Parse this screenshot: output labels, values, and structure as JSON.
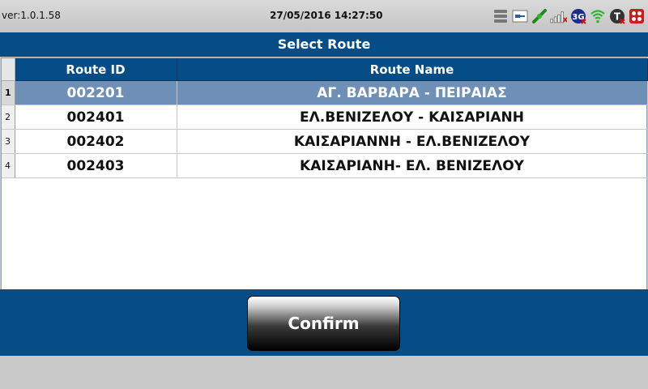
{
  "status_bar": {
    "version": "ver:1.0.1.58",
    "datetime": "27/05/2016 14:27:50",
    "icons": [
      "storage-icon",
      "card-reader-icon",
      "link-icon",
      "signal-bars-icon",
      "network-3g-icon",
      "wifi-icon",
      "t-icon",
      "tool-icon"
    ],
    "network_label": "3G",
    "t_label": "T"
  },
  "title": "Select Route",
  "table": {
    "columns": [
      "Route ID",
      "Route Name"
    ],
    "rows": [
      {
        "index": "1",
        "route_id": "002201",
        "route_name": "ΑΓ. ΒΑΡΒΑΡΑ - ΠΕΙΡΑΙΑΣ",
        "selected": true
      },
      {
        "index": "2",
        "route_id": "002401",
        "route_name": "ΕΛ.ΒΕΝΙΖΕΛΟΥ - ΚΑΙΣΑΡΙΑΝΗ",
        "selected": false
      },
      {
        "index": "3",
        "route_id": "002402",
        "route_name": "ΚΑΙΣΑΡΙΑΝΝΗ - ΕΛ.ΒΕΝΙΖΕΛΟΥ",
        "selected": false
      },
      {
        "index": "4",
        "route_id": "002403",
        "route_name": "ΚΑΙΣΑΡΙΑΝΗ- ΕΛ. ΒΕΝΙΖΕΛΟΥ",
        "selected": false
      }
    ]
  },
  "confirm_label": "Confirm",
  "colors": {
    "primary": "#054d86",
    "selected_row": "#6e8fb6",
    "background": "#c9c9c9"
  }
}
